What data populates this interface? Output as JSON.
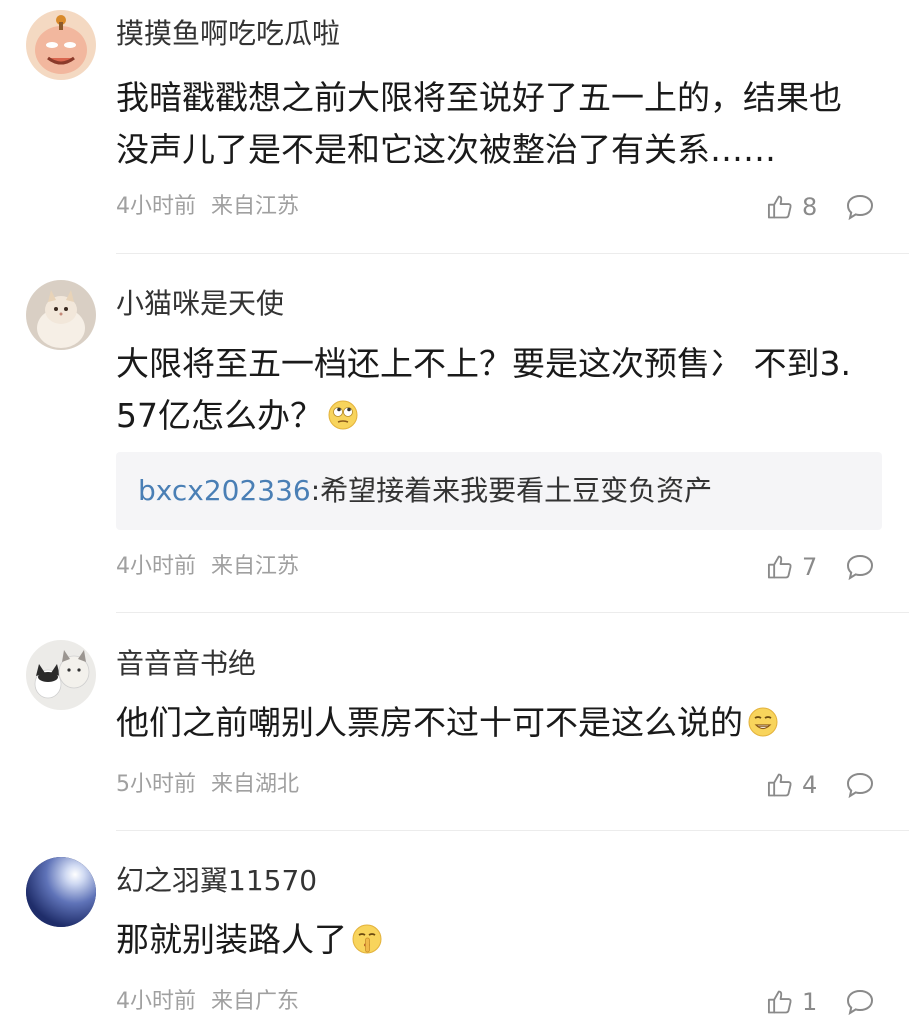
{
  "comments": [
    {
      "username": "摸摸鱼啊吃吃瓜啦",
      "text": "我暗戳戳想之前大限将至说好了五一上的，结果也没声儿了是不是和它这次被整治了有关系……",
      "time": "4小时前",
      "location": "来自江苏",
      "likes": "8",
      "avatar_icon": "cartoon-face-avatar"
    },
    {
      "username": "小猫咪是天使",
      "text": "大限将至五一档还上不上？要是这次预售冫 不到3.57亿怎么办？",
      "emoji": "eye-roll-emoji",
      "reply": {
        "user": "bxcx202336",
        "text": ":希望接着来我要看土豆变负资产"
      },
      "time": "4小时前",
      "location": "来自江苏",
      "likes": "7",
      "avatar_icon": "fluffy-cat-avatar"
    },
    {
      "username": "音音音书绝",
      "text": "他们之前嘲别人票房不过十可不是这么说的",
      "emoji": "smirk-emoji",
      "time": "5小时前",
      "location": "来自湖北",
      "likes": "4",
      "avatar_icon": "two-cats-avatar"
    },
    {
      "username": "幻之羽翼11570",
      "text": "那就别装路人了",
      "emoji": "shush-emoji",
      "time": "4小时前",
      "location": "来自广东",
      "likes": "1",
      "avatar_icon": "blue-sphere-avatar"
    }
  ],
  "colors": {
    "username": "#333333",
    "body": "#1a1a1a",
    "meta": "#a0a0a0",
    "reply_user": "#4a7fb5",
    "reply_bg": "#f5f5f7",
    "divider": "#ececec"
  }
}
